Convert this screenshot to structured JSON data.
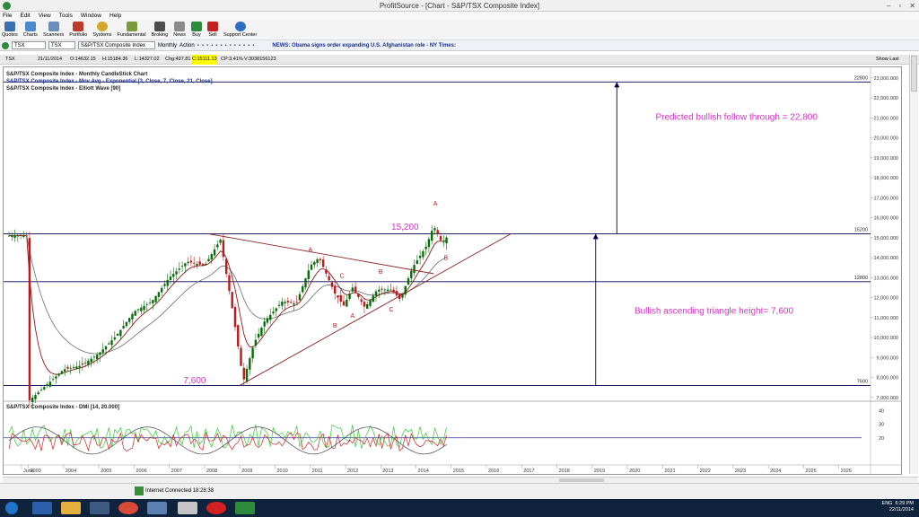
{
  "window": {
    "title": "ProfitSource - [Chart - S&P/TSX Composite Index]"
  },
  "menu": [
    "File",
    "Edit",
    "View",
    "Tools",
    "Window",
    "Help"
  ],
  "toolbar": [
    "Quotes",
    "Charts",
    "Scanners",
    "Portfolio",
    "Systems",
    "Fundamental",
    "Broking",
    "News",
    "Buy",
    "Sell",
    "Support Center"
  ],
  "symbolbar": {
    "symbol": "TSX",
    "exchange": "TSX",
    "name": "S&P/TSX Composite Index",
    "period": "Monthly",
    "action": "Action",
    "news": "NEWS: Obama signs order expanding U.S. Afghanistan role - NY Times:"
  },
  "quote": {
    "symbol": "TSX",
    "date": "21/11/2014",
    "open": "O:14632.15",
    "high": "H:15184.36",
    "low": "L:14327.02",
    "chg": "Chg:497.81",
    "cp": "CP:3.41%",
    "close": "C:15111.13",
    "vol": "V:3038156123",
    "show_last": "Show Last"
  },
  "chart_data": {
    "type": "candlestick",
    "title": "S&P/TSX Composite Index - Monthly CandleStick Chart",
    "overlays": [
      "S&P/TSX Composite Index - Mov Avg - Exponential [3, Close, 7, Close, 21, Close]",
      "S&P/TSX Composite Index - Elliott Wave [90]"
    ],
    "x_ticks": [
      "June",
      "2003",
      "2004",
      "2005",
      "2006",
      "2007",
      "2008",
      "2009",
      "2010",
      "2011",
      "2012",
      "2013",
      "2014",
      "2015",
      "2016",
      "2017",
      "2018",
      "2019",
      "2020",
      "2021",
      "2022",
      "2023",
      "2024",
      "2025",
      "2026"
    ],
    "y_ticks": [
      7000,
      8000,
      9000,
      10000,
      11000,
      12000,
      13000,
      14000,
      15000,
      16000,
      17000,
      18000,
      19000,
      20000,
      21000,
      22000,
      23000
    ],
    "ylim": [
      6900,
      23400
    ],
    "price_path": [
      [
        2003.0,
        6800
      ],
      [
        2003.5,
        7600
      ],
      [
        2004.0,
        8400
      ],
      [
        2004.5,
        8600
      ],
      [
        2005.0,
        9200
      ],
      [
        2005.5,
        10100
      ],
      [
        2006.0,
        11300
      ],
      [
        2006.5,
        11800
      ],
      [
        2007.0,
        13000
      ],
      [
        2007.5,
        13800
      ],
      [
        2008.0,
        13600
      ],
      [
        2008.45,
        14900
      ],
      [
        2008.8,
        11300
      ],
      [
        2009.1,
        7800
      ],
      [
        2009.4,
        9700
      ],
      [
        2009.7,
        10800
      ],
      [
        2010.2,
        11800
      ],
      [
        2010.6,
        11700
      ],
      [
        2011.0,
        13600
      ],
      [
        2011.25,
        14000
      ],
      [
        2011.7,
        12200
      ],
      [
        2011.95,
        11600
      ],
      [
        2012.2,
        12500
      ],
      [
        2012.55,
        11500
      ],
      [
        2012.9,
        12400
      ],
      [
        2013.3,
        12400
      ],
      [
        2013.55,
        11900
      ],
      [
        2013.9,
        13500
      ],
      [
        2014.3,
        14600
      ],
      [
        2014.5,
        15600
      ],
      [
        2014.75,
        14700
      ],
      [
        2014.9,
        15100
      ]
    ],
    "horizontal_lines": [
      {
        "value": 22800,
        "label": "22800"
      },
      {
        "value": 15200,
        "label": "15200"
      },
      {
        "value": 12800,
        "label": "12800"
      },
      {
        "value": 7600,
        "label": "7600"
      }
    ],
    "trendlines": [
      [
        [
          2008.1,
          15200
        ],
        [
          2014.5,
          13200
        ]
      ],
      [
        [
          2009.0,
          7600
        ],
        [
          2016.7,
          15200
        ]
      ]
    ],
    "arrows": [
      [
        [
          2019.1,
          7600
        ],
        [
          2019.1,
          15200
        ]
      ],
      [
        [
          2019.7,
          15200
        ],
        [
          2019.7,
          22800
        ]
      ]
    ],
    "wave_labels": [
      {
        "text": "A",
        "x": 2011.0,
        "y": 14300
      },
      {
        "text": "B",
        "x": 2011.7,
        "y": 10500
      },
      {
        "text": "C",
        "x": 2011.9,
        "y": 13000
      },
      {
        "text": "A",
        "x": 2012.2,
        "y": 11000
      },
      {
        "text": "B",
        "x": 2013.0,
        "y": 13200
      },
      {
        "text": "C",
        "x": 2013.3,
        "y": 11300
      },
      {
        "text": "A",
        "x": 2014.55,
        "y": 16600
      },
      {
        "text": "B",
        "x": 2014.85,
        "y": 13900
      }
    ],
    "annotations": [
      {
        "text": "Predicted bullish follow through = 22,800",
        "x": 2020.8,
        "y": 20900
      },
      {
        "text": "Bullish ascending triangle height= 7,600",
        "x": 2020.2,
        "y": 11200
      },
      {
        "text": "15,200",
        "x": 2013.3,
        "y": 15400
      },
      {
        "text": "7,600",
        "x": 2007.4,
        "y": 7700
      }
    ],
    "indicator": {
      "title": "S&P/TSX Composite Index - DMI [14, 20.000]",
      "y_ticks": [
        20,
        30,
        40
      ],
      "ylim": [
        0,
        47
      ]
    },
    "colors": {
      "trend": "#8b2323",
      "line": "#000050",
      "annotation": "#d634c5",
      "up": "#0a6b0a",
      "down": "#c01818",
      "ema1": "#8b1a1a",
      "ema2": "#6a6a6a"
    }
  },
  "status": {
    "connection": "Internet Connected 18:28:38"
  },
  "tray": {
    "lang": "ENG",
    "time": "6:29 PM",
    "date": "22/11/2014"
  }
}
